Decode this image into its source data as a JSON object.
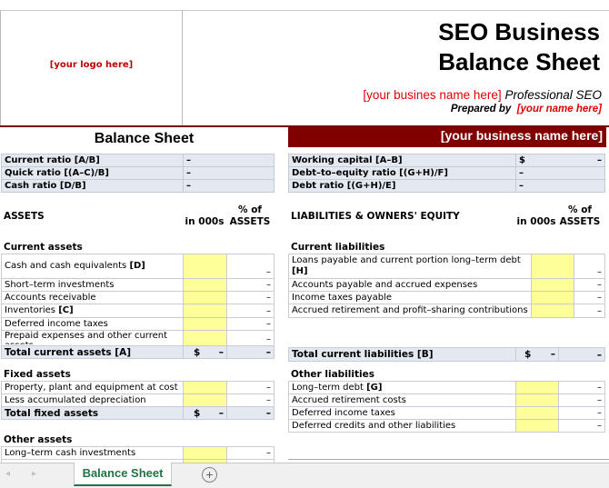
{
  "header": {
    "logo_placeholder": "[your logo here]",
    "title_line1": "SEO Business",
    "title_line2": "Balance Sheet",
    "business_name": "[your busines name here]",
    "tagline": "Professional SEO",
    "prepared_by_label": "Prepared by",
    "prepared_by_name": "[your name here]"
  },
  "sheet_title": "Balance Sheet",
  "business_band": "[your business name here]",
  "ratios_left": [
    {
      "label": "Current ratio  [A/B]",
      "value": "–"
    },
    {
      "label": "Quick ratio  [(A–C)/B]",
      "value": "–"
    },
    {
      "label": "Cash ratio  [D/B]",
      "value": "–"
    }
  ],
  "ratios_right": [
    {
      "label": "Working capital  [A–B]",
      "currency": "$",
      "value": "–"
    },
    {
      "label": "Debt–to–equity ratio  [(G+H)/F]",
      "currency": "",
      "value": "–"
    },
    {
      "label": "Debt ratio  [(G+H)/E]",
      "currency": "",
      "value": "–"
    }
  ],
  "assets": {
    "heading": "ASSETS",
    "col_in": "in 000s",
    "col_pct_line1": "% of",
    "col_pct_line2": "ASSETS",
    "current": {
      "heading": "Current assets",
      "rows": [
        {
          "label": "Cash and cash equivalents",
          "ref": "[D]",
          "value": "",
          "pct": "–"
        },
        {
          "label": "Short–term investments",
          "ref": "",
          "value": "",
          "pct": "–"
        },
        {
          "label": "Accounts receivable",
          "ref": "",
          "value": "",
          "pct": "–"
        },
        {
          "label": "Inventories",
          "ref": "[C]",
          "value": "",
          "pct": "–"
        },
        {
          "label": "Deferred income taxes",
          "ref": "",
          "value": "",
          "pct": "–"
        },
        {
          "label": "Prepaid expenses and other current assets",
          "ref": "",
          "value": "",
          "pct": "–"
        }
      ],
      "total": {
        "label": "Total current assets  [A]",
        "currency": "$",
        "value": "–",
        "pct": "–"
      }
    },
    "fixed": {
      "heading": "Fixed assets",
      "rows": [
        {
          "label": "Property, plant and equipment at cost",
          "value": "",
          "pct": "–"
        },
        {
          "label": "Less accumulated depreciation",
          "value": "",
          "pct": "–"
        }
      ],
      "total": {
        "label": "Total fixed assets",
        "currency": "$",
        "value": "–",
        "pct": "–"
      }
    },
    "other": {
      "heading": "Other assets",
      "rows": [
        {
          "label": "Long–term cash investments",
          "value": "",
          "pct": "–"
        }
      ]
    }
  },
  "liabilities": {
    "heading": "LIABILITIES & OWNERS' EQUITY",
    "col_in": "in 000s",
    "col_pct_line1": "% of",
    "col_pct_line2": "ASSETS",
    "current": {
      "heading": "Current liabilities",
      "rows": [
        {
          "label": "Loans payable and current portion long–term debt",
          "ref": "[H]",
          "value": "",
          "pct": "–"
        },
        {
          "label": "Accounts payable and accrued expenses",
          "ref": "",
          "value": "",
          "pct": "–"
        },
        {
          "label": "Income taxes payable",
          "ref": "",
          "value": "",
          "pct": "–"
        },
        {
          "label": "Accrued retirement and profit–sharing contributions",
          "ref": "",
          "value": "",
          "pct": "–"
        }
      ],
      "total": {
        "label": "Total current liabilities  [B]",
        "currency": "$",
        "value": "–",
        "pct": "–"
      }
    },
    "other": {
      "heading": "Other liabilities",
      "rows": [
        {
          "label": "Long–term debt",
          "ref": "[G]",
          "value": "",
          "pct": "–"
        },
        {
          "label": "Accrued retirement costs",
          "ref": "",
          "value": "",
          "pct": "–"
        },
        {
          "label": "Deferred income taxes",
          "ref": "",
          "value": "",
          "pct": "–"
        },
        {
          "label": "Deferred credits and other liabilities",
          "ref": "",
          "value": "",
          "pct": "–"
        }
      ]
    }
  },
  "tabs": {
    "nav_prev": "◂",
    "nav_next": "▸",
    "active_sheet": "Balance Sheet",
    "add_sheet": "+"
  }
}
